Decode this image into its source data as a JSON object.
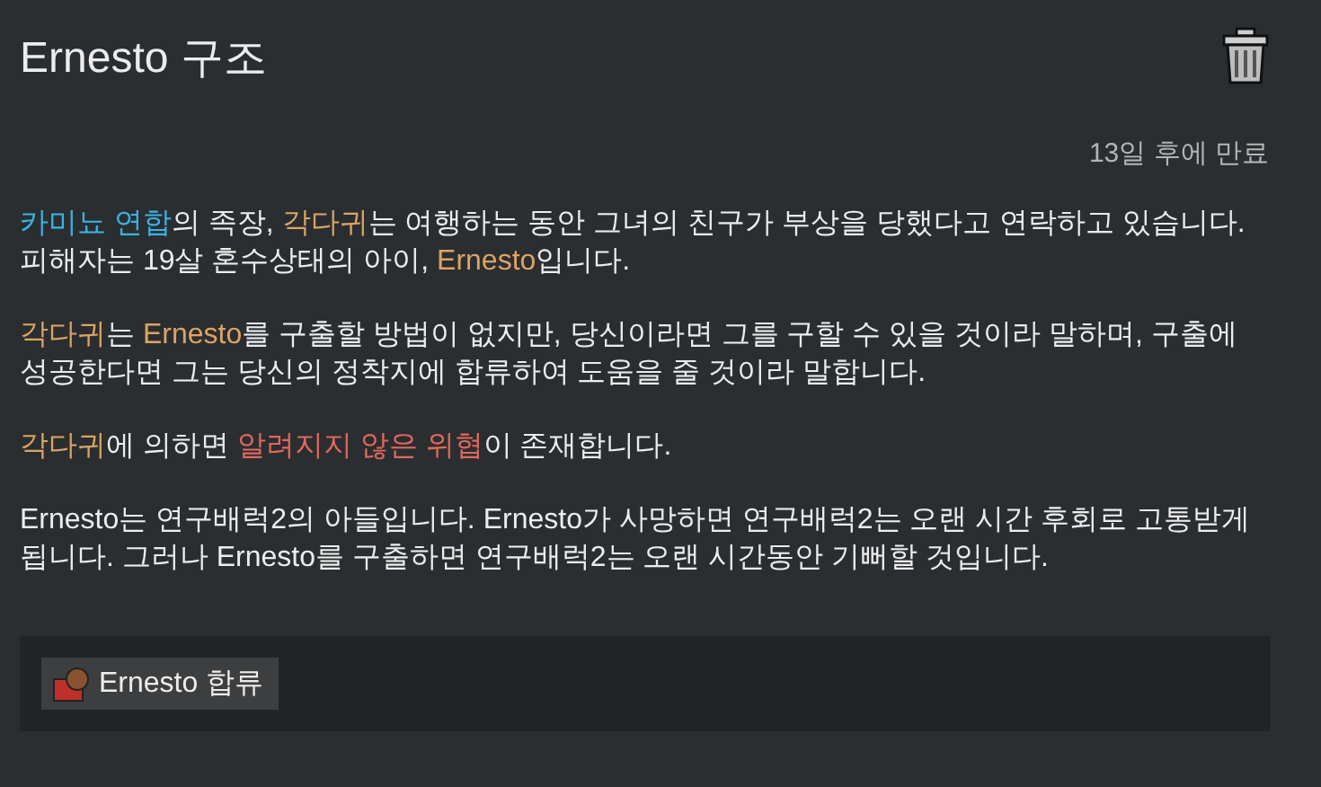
{
  "title": "Ernesto 구조",
  "expiry": "13일 후에 만료",
  "paragraphs": [
    [
      {
        "text": "카미뇨 연합",
        "color": "#3ab4e6"
      },
      {
        "text": "의 족장, "
      },
      {
        "text": "각다귀",
        "color": "#dba464"
      },
      {
        "text": "는 여행하는 동안 그녀의 친구가 부상을 당했다고 연락하고 있습니다. 피해자는 19살 혼수상태의 아이, "
      },
      {
        "text": "Ernesto",
        "color": "#dba464"
      },
      {
        "text": "입니다."
      }
    ],
    [
      {
        "text": "각다귀",
        "color": "#dba464"
      },
      {
        "text": "는 "
      },
      {
        "text": "Ernesto",
        "color": "#dba464"
      },
      {
        "text": "를 구출할 방법이 없지만, 당신이라면 그를 구할 수 있을 것이라 말하며, 구출에 성공한다면 그는 당신의 정착지에 합류하여 도움을 줄 것이라 말합니다."
      }
    ],
    [
      {
        "text": "각다귀",
        "color": "#dba464"
      },
      {
        "text": "에 의하면 "
      },
      {
        "text": "알려지지 않은 위협",
        "color": "#e0685c"
      },
      {
        "text": "이 존재합니다."
      }
    ],
    [
      {
        "text": "Ernesto는 연구배럭2의 아들입니다. Ernesto가 사망하면 연구배럭2는 오랜 시간 후회로 고통받게 됩니다. 그러나 Ernesto를 구출하면 연구배럭2는 오랜 시간동안 기뻐할 것입니다."
      }
    ]
  ],
  "rewards": [
    {
      "label": "Ernesto 합류"
    }
  ]
}
